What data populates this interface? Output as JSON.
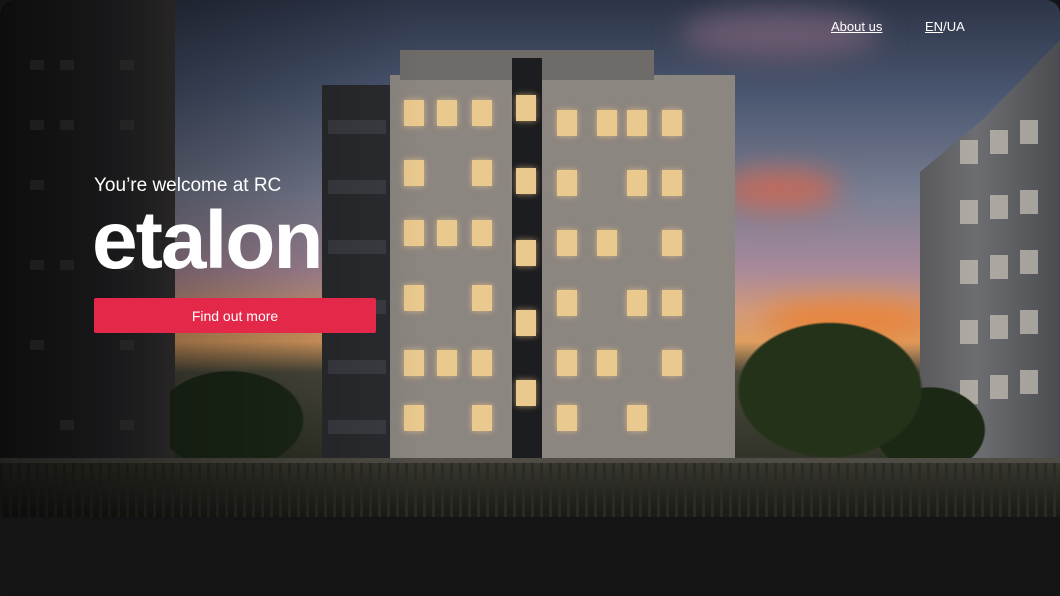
{
  "nav": {
    "about_label": "About us",
    "lang_en": "EN",
    "lang_sep": "/",
    "lang_ua": "UA"
  },
  "hero": {
    "welcome_text": "You’re welcome at RC",
    "brand_logo_text": "etalon",
    "cta_label": "Find out more"
  },
  "colors": {
    "accent": "#e4284a",
    "text": "#ffffff",
    "bottom_bar": "#141414"
  }
}
